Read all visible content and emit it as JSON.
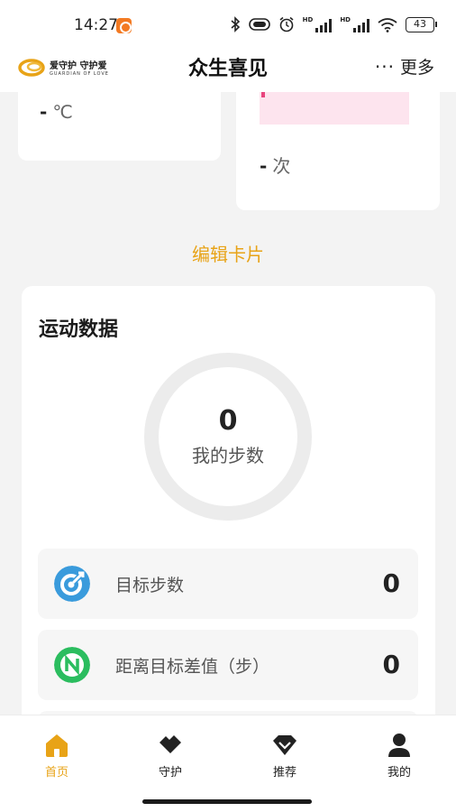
{
  "status_bar": {
    "time": "14:27",
    "battery": "43",
    "hd1": "HD",
    "hd2": "HD"
  },
  "header": {
    "logo_text": "爱守护 守护爱",
    "logo_sub": "GUARDIAN OF LOVE",
    "title": "众生喜见",
    "more_dots": "···",
    "more_label": "更多"
  },
  "cards_top": {
    "left_dash": "-",
    "left_unit": "℃",
    "right_dash": "-",
    "right_unit": "次"
  },
  "edit_cards": "编辑卡片",
  "sport": {
    "title": "运动数据",
    "steps_value": "0",
    "steps_label": "我的步数",
    "rows": [
      {
        "label": "目标步数",
        "value": "0",
        "icon": "target-icon"
      },
      {
        "label": "距离目标差值（步）",
        "value": "0",
        "icon": "n-badge-icon"
      }
    ]
  },
  "nav": {
    "items": [
      {
        "label": "首页",
        "icon": "home-icon"
      },
      {
        "label": "守护",
        "icon": "guard-icon"
      },
      {
        "label": "推荐",
        "icon": "diamond-icon"
      },
      {
        "label": "我的",
        "icon": "user-icon"
      }
    ]
  },
  "colors": {
    "accent": "#e8a317",
    "target_icon": "#3a9bdc",
    "badge_icon": "#2bbd5f"
  }
}
